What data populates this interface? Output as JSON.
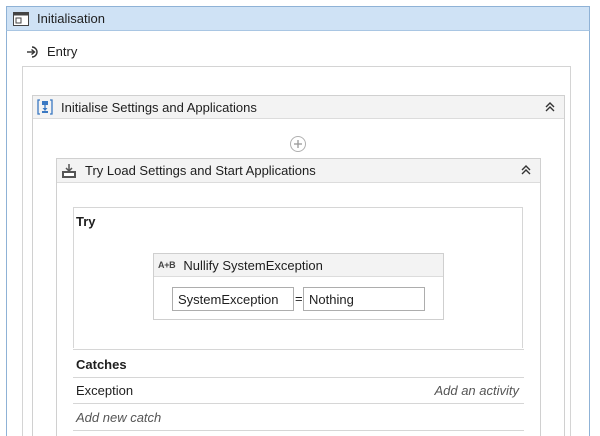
{
  "state": {
    "title": "Initialisation",
    "icon": "state-window-icon"
  },
  "entry": {
    "label": "Entry",
    "icon": "entry-arrow-icon"
  },
  "sequence": {
    "title": "Initialise Settings and Applications",
    "icon": "sequence-icon",
    "collapse_icon": "double-chevron-up-icon"
  },
  "add_activity_icon": "plus-circle-icon",
  "try_catch": {
    "title": "Try Load Settings and Start Applications",
    "icon": "try-catch-icon",
    "collapse_icon": "double-chevron-up-icon",
    "try_label": "Try",
    "assign": {
      "badge": "A+B",
      "title": "Nullify SystemException",
      "to": "SystemException",
      "operator": "=",
      "value": "Nothing"
    },
    "catches_label": "Catches",
    "catches": [
      {
        "exception": "Exception",
        "action": "Add an activity"
      }
    ],
    "add_catch_label": "Add new catch"
  }
}
